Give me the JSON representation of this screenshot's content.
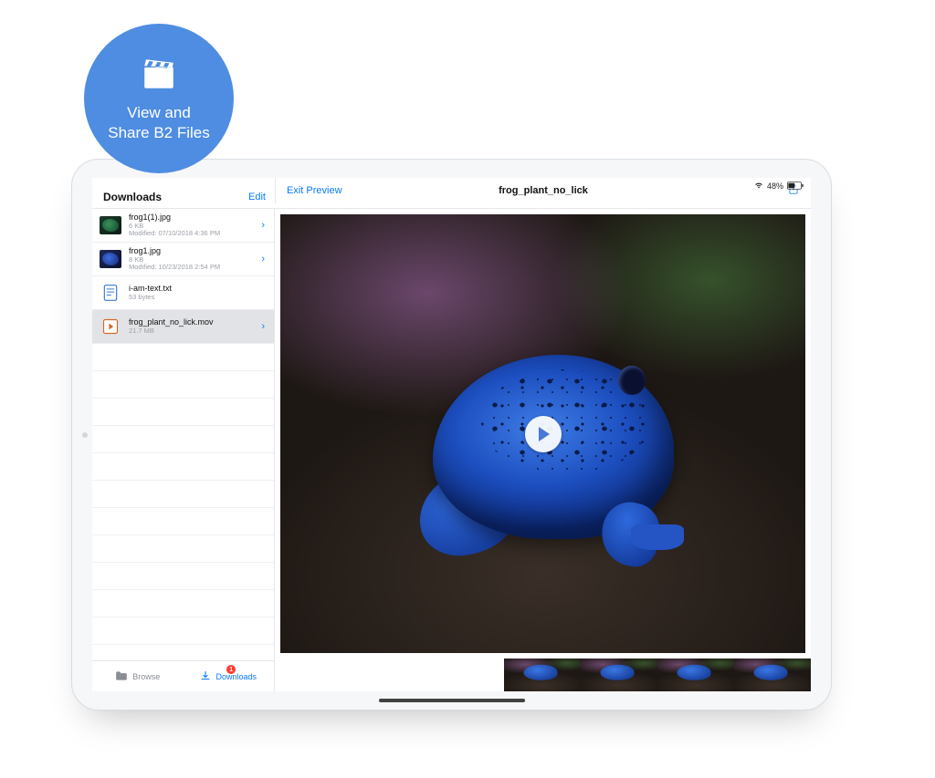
{
  "badge": {
    "line1": "View and",
    "line2": "Share B2 Files"
  },
  "statusbar": {
    "battery_percent": "48%"
  },
  "sidebar": {
    "header_title": "Downloads",
    "edit_label": "Edit",
    "files": [
      {
        "name": "frog1(1).jpg",
        "size": "6 KB",
        "modified": "Modified: 07/10/2018 4:36 PM",
        "thumb": "frog-green",
        "chevron": true
      },
      {
        "name": "frog1.jpg",
        "size": "8 KB",
        "modified": "Modified: 10/23/2018 2:54 PM",
        "thumb": "frog-blue",
        "chevron": true
      },
      {
        "name": "i-am-text.txt",
        "size": "53 bytes",
        "modified": "",
        "thumb": "text",
        "chevron": false
      },
      {
        "name": "frog_plant_no_lick.mov",
        "size": "21.7 MB",
        "modified": "",
        "thumb": "mov",
        "chevron": true,
        "selected": true
      }
    ]
  },
  "tabs": {
    "browse_label": "Browse",
    "downloads_label": "Downloads",
    "downloads_badge": "1"
  },
  "preview": {
    "exit_label": "Exit Preview",
    "title": "frog_plant_no_lick"
  },
  "colors": {
    "accent": "#0a7aff",
    "badge_bg": "#4e8de1",
    "notif_red": "#ff3b30"
  }
}
